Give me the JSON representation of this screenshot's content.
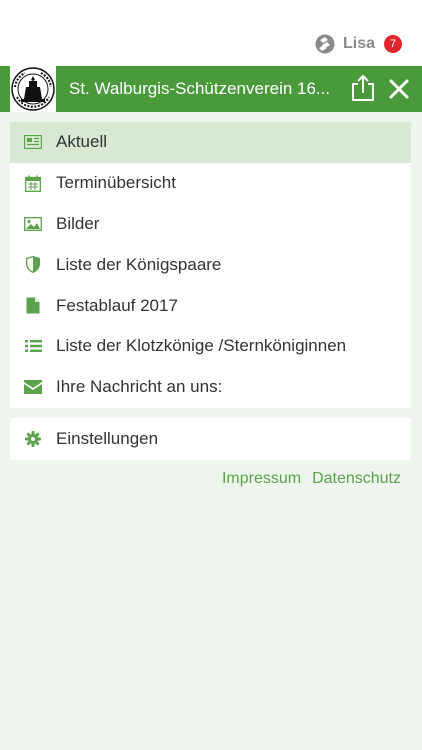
{
  "statusbar": {
    "user_name": "Lisa",
    "notification_count": "7"
  },
  "appbar": {
    "title": "St. Walburgis-Schützenverein 16...",
    "logo_text": "SCHÜTZENVEREIN"
  },
  "menu": {
    "items": [
      {
        "label": "Aktuell",
        "icon": "newspaper-icon",
        "active": true
      },
      {
        "label": "Terminübersicht",
        "icon": "calendar-icon",
        "active": false
      },
      {
        "label": "Bilder",
        "icon": "image-icon",
        "active": false
      },
      {
        "label": "Liste der Königspaare",
        "icon": "shield-icon",
        "active": false
      },
      {
        "label": "Festablauf 2017",
        "icon": "file-icon",
        "active": false
      },
      {
        "label": "Liste der Klotzkönige /Sternköniginnen",
        "icon": "list-icon",
        "active": false
      },
      {
        "label": "Ihre Nachricht an uns:",
        "icon": "envelope-icon",
        "active": false
      }
    ],
    "settings_label": "Einstellungen"
  },
  "footer": {
    "impressum": "Impressum",
    "datenschutz": "Datenschutz"
  },
  "colors": {
    "accent": "#4a9a3c",
    "icon": "#5aa24c",
    "active_bg": "#d8e8d3",
    "background": "#eef5ec",
    "badge": "#e0262c"
  }
}
